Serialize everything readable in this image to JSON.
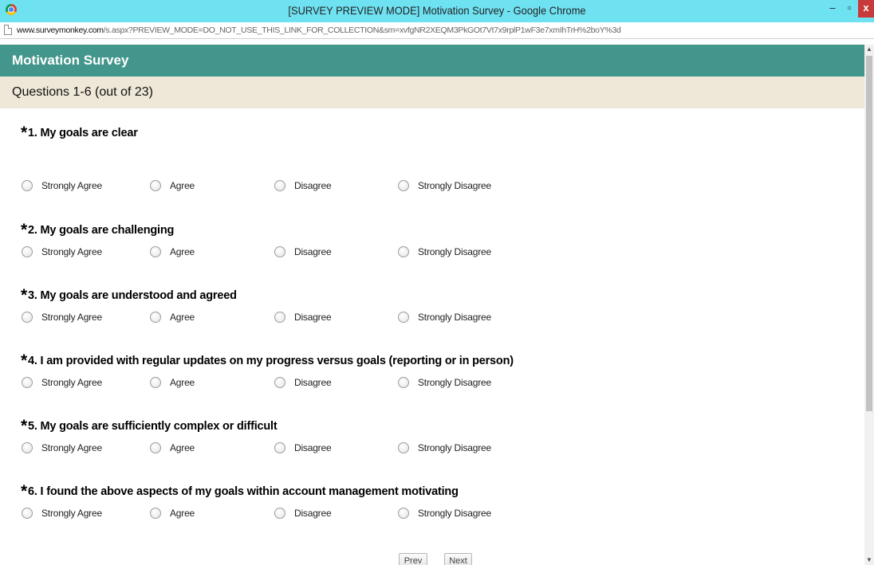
{
  "window": {
    "title": "[SURVEY PREVIEW MODE] Motivation Survey - Google Chrome",
    "minimize": "–",
    "maximize": "▫",
    "close": "x"
  },
  "address": {
    "domain": "www.surveymonkey.com",
    "path": "/s.aspx?PREVIEW_MODE=DO_NOT_USE_THIS_LINK_FOR_COLLECTION&sm=xvfgNR2XEQM3PkGOt7Vt7x9rplP1wF3e7xmIhTrH%2boY%3d"
  },
  "survey": {
    "title": "Motivation Survey",
    "progress": "Questions 1-6 (out of 23)",
    "required_marker": "*",
    "options": [
      "Strongly Agree",
      "Agree",
      "Disagree",
      "Strongly Disagree"
    ],
    "questions": [
      {
        "number": "1.",
        "text": "My goals are clear"
      },
      {
        "number": "2.",
        "text": "My goals are challenging"
      },
      {
        "number": "3.",
        "text": "My goals are understood and agreed"
      },
      {
        "number": "4.",
        "text": "I am provided with regular updates on my progress versus goals (reporting or in person)"
      },
      {
        "number": "5.",
        "text": "My goals are sufficiently complex or difficult"
      },
      {
        "number": "6.",
        "text": "I found the above aspects of my goals within account management motivating"
      }
    ],
    "prev_label": "Prev",
    "next_label": "Next"
  },
  "scrollbar": {
    "up_arrow": "▲",
    "down_arrow": "▼"
  },
  "colors": {
    "titlebar": "#6fe2f2",
    "survey_header": "#43968b",
    "page_banner": "#efe8d8",
    "close_button": "#c7393a"
  }
}
